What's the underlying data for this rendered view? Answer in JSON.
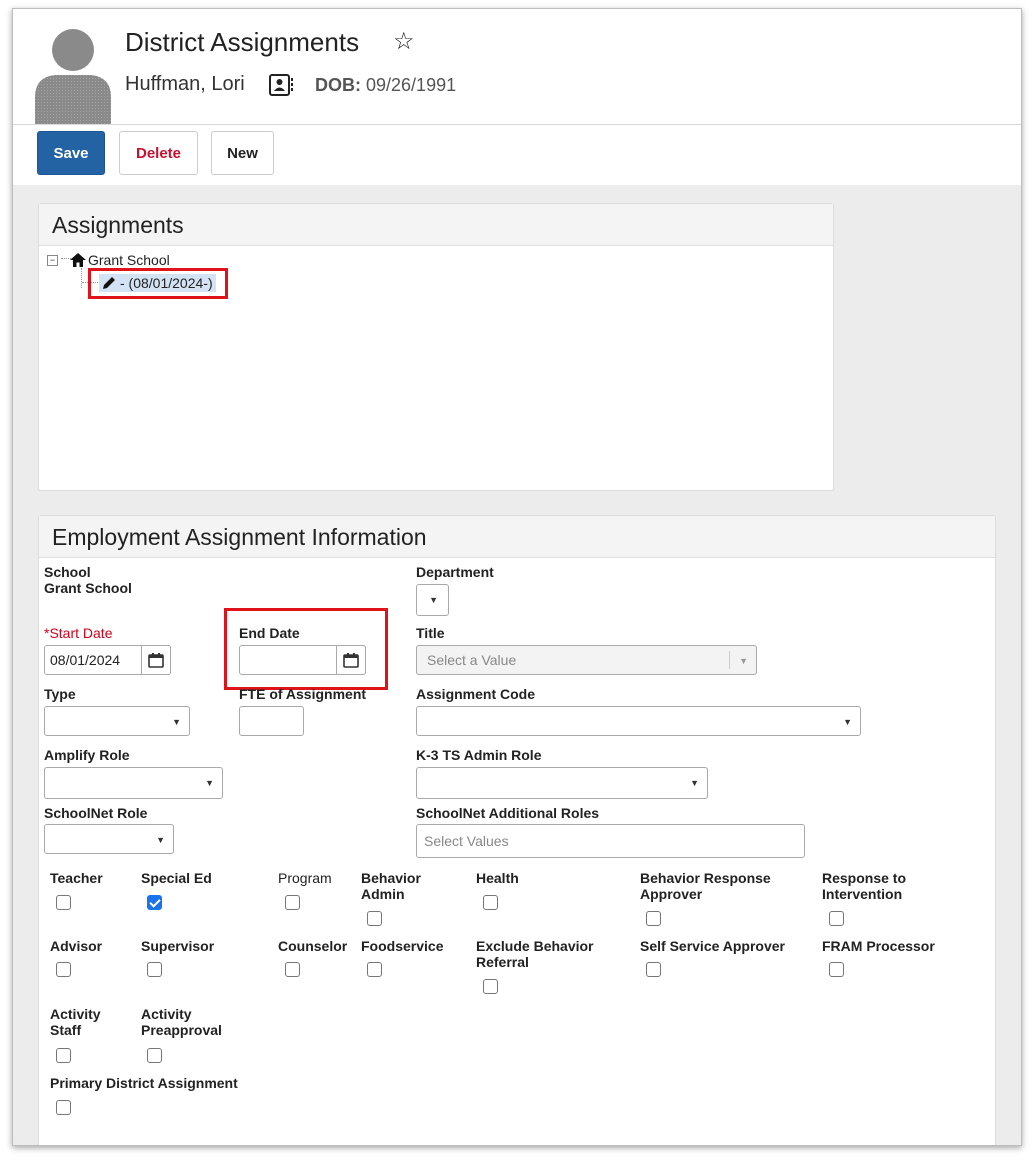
{
  "header": {
    "title": "District Assignments",
    "person_name": "Huffman, Lori",
    "dob_label": "DOB:",
    "dob_value": "09/26/1991"
  },
  "toolbar": {
    "save_label": "Save",
    "delete_label": "Delete",
    "new_label": "New"
  },
  "assignments_panel": {
    "heading": "Assignments",
    "tree_root": "Grant School",
    "tree_child": "- (08/01/2024-)"
  },
  "employment_panel": {
    "heading": "Employment Assignment Information",
    "school_label": "School",
    "school_value": "Grant School",
    "department_label": "Department",
    "start_date_label": "Start Date",
    "start_date_value": "08/01/2024",
    "end_date_label": "End Date",
    "end_date_value": "",
    "title_label": "Title",
    "title_placeholder": "Select a Value",
    "type_label": "Type",
    "fte_label": "FTE of Assignment",
    "assignment_code_label": "Assignment Code",
    "amplify_role_label": "Amplify Role",
    "k3_role_label": "K-3 TS Admin Role",
    "schoolnet_role_label": "SchoolNet Role",
    "schoolnet_additional_label": "SchoolNet Additional Roles",
    "schoolnet_additional_placeholder": "Select Values",
    "checkboxes": {
      "teacher": "Teacher",
      "special_ed": "Special Ed",
      "program": "Program",
      "behavior_admin": "Behavior Admin",
      "health": "Health",
      "behavior_response_approver": "Behavior Response Approver",
      "response_to_intervention": "Response to Intervention",
      "advisor": "Advisor",
      "supervisor": "Supervisor",
      "counselor": "Counselor",
      "foodservice": "Foodservice",
      "exclude_behavior_referral": "Exclude Behavior Referral",
      "self_service_approver": "Self Service Approver",
      "fram_processor": "FRAM Processor",
      "activity_staff": "Activity Staff",
      "activity_preapproval": "Activity Preapproval",
      "primary_district_assignment": "Primary District Assignment"
    },
    "checked": {
      "special_ed": true
    }
  },
  "colors": {
    "primary": "#2463a3",
    "danger": "#c8102e",
    "highlight": "#e0131a",
    "check": "#1a73e8"
  }
}
